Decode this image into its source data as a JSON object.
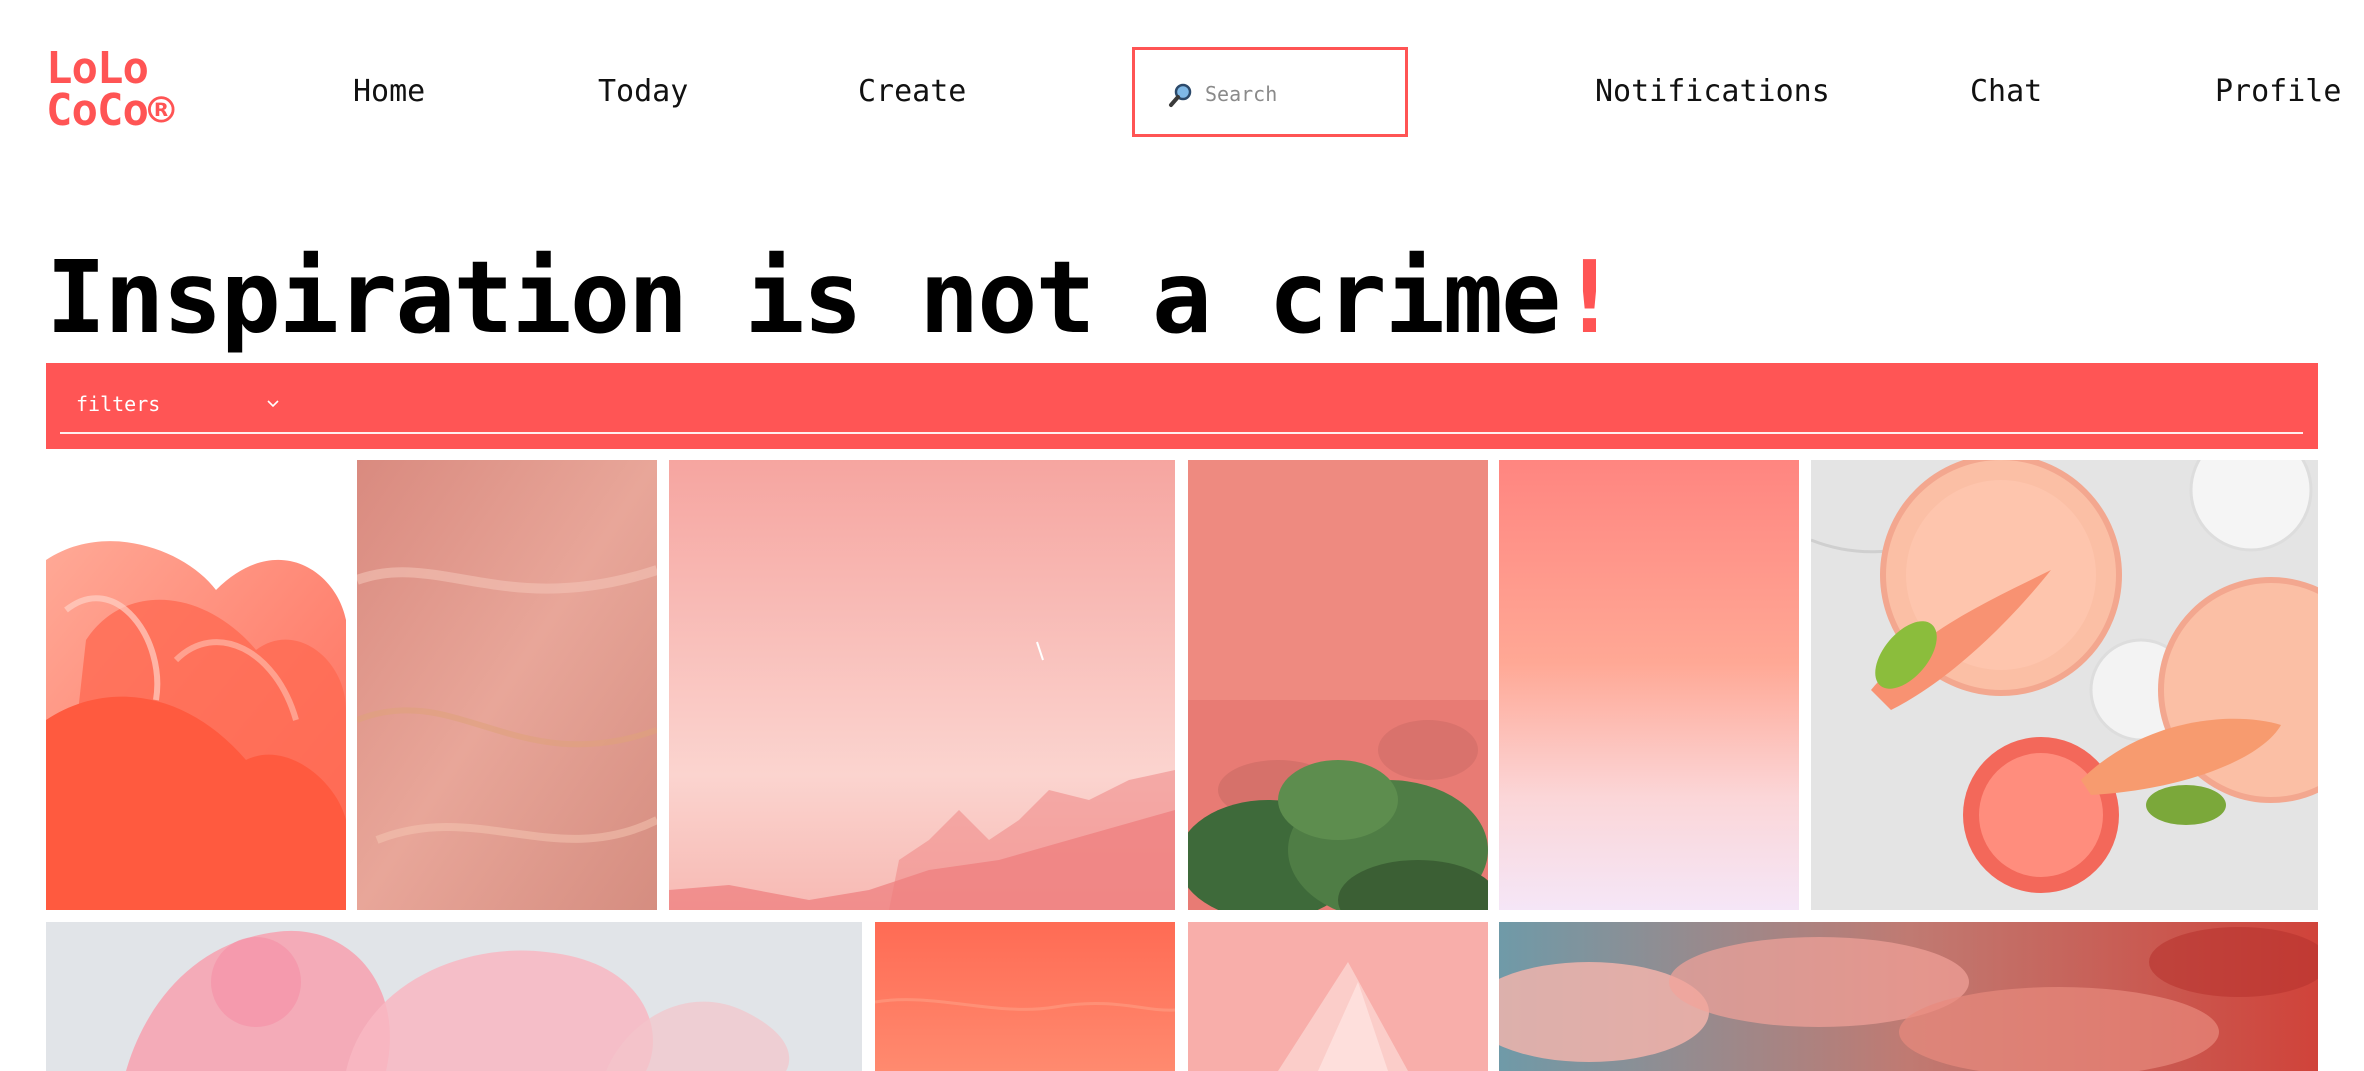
{
  "brand": {
    "line1": "LoLo",
    "line2": "CoCo®"
  },
  "nav": {
    "home": "Home",
    "today": "Today",
    "create": "Create",
    "notifications": "Notifications",
    "chat": "Chat",
    "profile": "Profile"
  },
  "search": {
    "placeholder": "Search",
    "icon": "magnifier-icon"
  },
  "headline": {
    "text": "Inspiration is not a crime",
    "punct": "!"
  },
  "filters": {
    "label": "filters",
    "icon": "chevron-down-icon"
  },
  "colors": {
    "accent": "#ff5454",
    "text": "#111111",
    "background": "#ffffff"
  }
}
